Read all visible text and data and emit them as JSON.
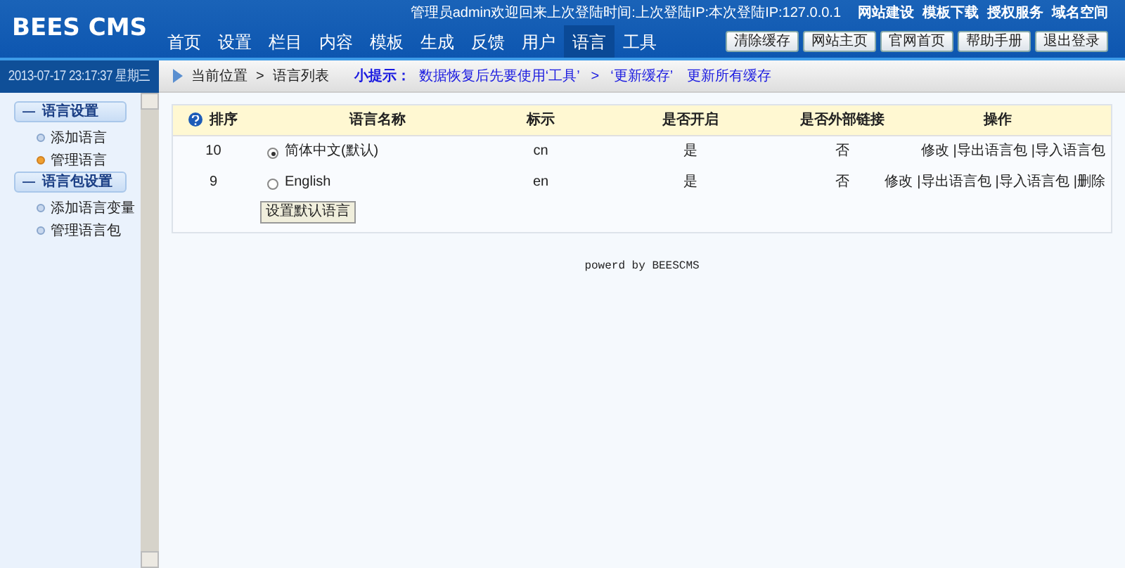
{
  "logo": "BEES CMS",
  "welcome": "管理员admin欢迎回来上次登陆时间:上次登陆IP:本次登陆IP:127.0.0.1",
  "top_links": [
    "网站建设",
    "模板下载",
    "授权服务",
    "域名空间"
  ],
  "nav": [
    {
      "label": "首页",
      "selected": false
    },
    {
      "label": "设置",
      "selected": false
    },
    {
      "label": "栏目",
      "selected": false
    },
    {
      "label": "内容",
      "selected": false
    },
    {
      "label": "模板",
      "selected": false
    },
    {
      "label": "生成",
      "selected": false
    },
    {
      "label": "反馈",
      "selected": false
    },
    {
      "label": "用户",
      "selected": false
    },
    {
      "label": "语言",
      "selected": true
    },
    {
      "label": "工具",
      "selected": false
    }
  ],
  "header_buttons": [
    "清除缓存",
    "网站主页",
    "官网首页",
    "帮助手册",
    "退出登录"
  ],
  "datetime": "2013-07-17 23:17:37 星期三",
  "breadcrumb": {
    "label": "当前位置",
    "separator": ">",
    "current": "语言列表"
  },
  "tip": {
    "label": "小提示：",
    "text": "数据恢复后先要使用‘工具’",
    "arrow": ">",
    "quote": "‘更新缓存’",
    "link": "更新所有缓存"
  },
  "sidebar": [
    {
      "symbol": "—",
      "label": "语言设置",
      "items": [
        {
          "label": "添加语言",
          "selected": false
        },
        {
          "label": "管理语言",
          "selected": true
        }
      ]
    },
    {
      "symbol": "—",
      "label": "语言包设置",
      "items": [
        {
          "label": "添加语言变量",
          "selected": false
        },
        {
          "label": "管理语言包",
          "selected": false
        }
      ]
    }
  ],
  "table": {
    "columns": [
      "排序",
      "语言名称",
      "标示",
      "是否开启",
      "是否外部链接",
      "操作"
    ],
    "action_separator": "|",
    "rows": [
      {
        "order": "10",
        "name": "简体中文(默认)",
        "selected": true,
        "code": "cn",
        "enabled": "是",
        "external": "否",
        "actions": [
          "修改",
          "导出语言包",
          "导入语言包"
        ]
      },
      {
        "order": "9",
        "name": "English",
        "selected": false,
        "code": "en",
        "enabled": "是",
        "external": "否",
        "actions": [
          "修改",
          "导出语言包",
          "导入语言包",
          "删除"
        ]
      }
    ],
    "button": "设置默认语言"
  },
  "footer": "powerd by BEESCMS"
}
